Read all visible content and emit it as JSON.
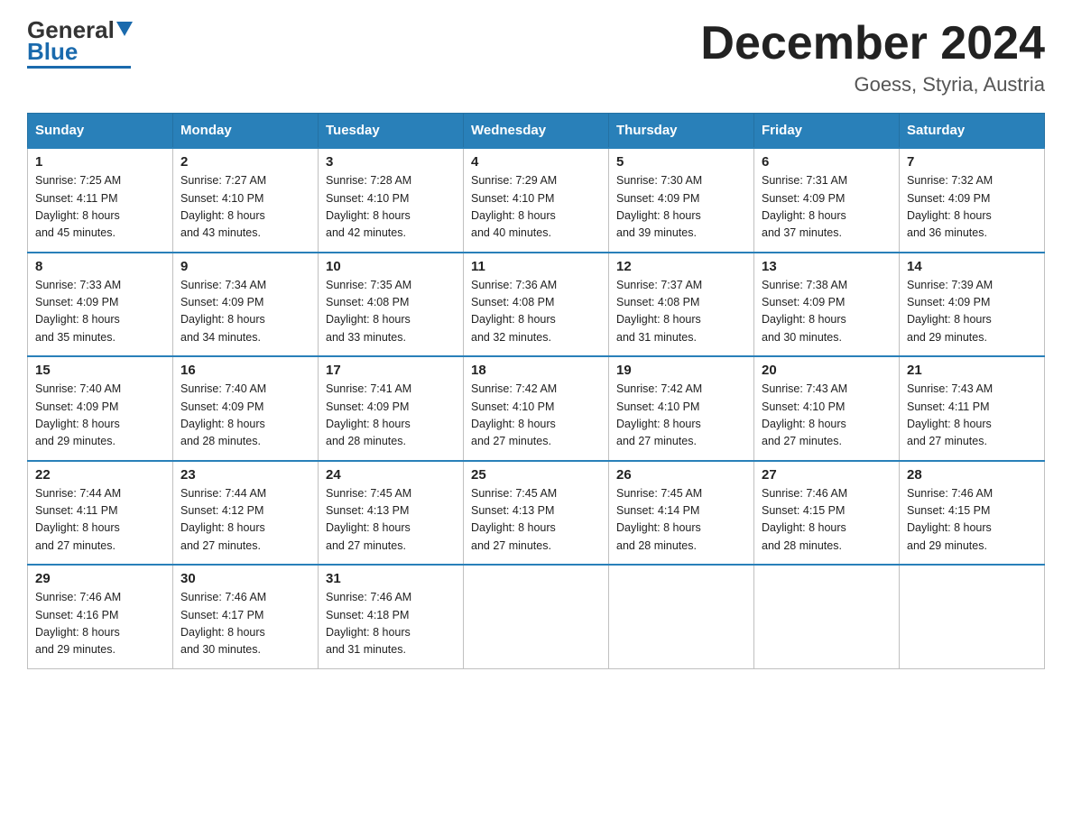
{
  "logo": {
    "general": "General",
    "blue": "Blue"
  },
  "title": "December 2024",
  "subtitle": "Goess, Styria, Austria",
  "weekdays": [
    "Sunday",
    "Monday",
    "Tuesday",
    "Wednesday",
    "Thursday",
    "Friday",
    "Saturday"
  ],
  "weeks": [
    [
      {
        "day": "1",
        "sunrise": "7:25 AM",
        "sunset": "4:11 PM",
        "daylight": "8 hours and 45 minutes."
      },
      {
        "day": "2",
        "sunrise": "7:27 AM",
        "sunset": "4:10 PM",
        "daylight": "8 hours and 43 minutes."
      },
      {
        "day": "3",
        "sunrise": "7:28 AM",
        "sunset": "4:10 PM",
        "daylight": "8 hours and 42 minutes."
      },
      {
        "day": "4",
        "sunrise": "7:29 AM",
        "sunset": "4:10 PM",
        "daylight": "8 hours and 40 minutes."
      },
      {
        "day": "5",
        "sunrise": "7:30 AM",
        "sunset": "4:09 PM",
        "daylight": "8 hours and 39 minutes."
      },
      {
        "day": "6",
        "sunrise": "7:31 AM",
        "sunset": "4:09 PM",
        "daylight": "8 hours and 37 minutes."
      },
      {
        "day": "7",
        "sunrise": "7:32 AM",
        "sunset": "4:09 PM",
        "daylight": "8 hours and 36 minutes."
      }
    ],
    [
      {
        "day": "8",
        "sunrise": "7:33 AM",
        "sunset": "4:09 PM",
        "daylight": "8 hours and 35 minutes."
      },
      {
        "day": "9",
        "sunrise": "7:34 AM",
        "sunset": "4:09 PM",
        "daylight": "8 hours and 34 minutes."
      },
      {
        "day": "10",
        "sunrise": "7:35 AM",
        "sunset": "4:08 PM",
        "daylight": "8 hours and 33 minutes."
      },
      {
        "day": "11",
        "sunrise": "7:36 AM",
        "sunset": "4:08 PM",
        "daylight": "8 hours and 32 minutes."
      },
      {
        "day": "12",
        "sunrise": "7:37 AM",
        "sunset": "4:08 PM",
        "daylight": "8 hours and 31 minutes."
      },
      {
        "day": "13",
        "sunrise": "7:38 AM",
        "sunset": "4:09 PM",
        "daylight": "8 hours and 30 minutes."
      },
      {
        "day": "14",
        "sunrise": "7:39 AM",
        "sunset": "4:09 PM",
        "daylight": "8 hours and 29 minutes."
      }
    ],
    [
      {
        "day": "15",
        "sunrise": "7:40 AM",
        "sunset": "4:09 PM",
        "daylight": "8 hours and 29 minutes."
      },
      {
        "day": "16",
        "sunrise": "7:40 AM",
        "sunset": "4:09 PM",
        "daylight": "8 hours and 28 minutes."
      },
      {
        "day": "17",
        "sunrise": "7:41 AM",
        "sunset": "4:09 PM",
        "daylight": "8 hours and 28 minutes."
      },
      {
        "day": "18",
        "sunrise": "7:42 AM",
        "sunset": "4:10 PM",
        "daylight": "8 hours and 27 minutes."
      },
      {
        "day": "19",
        "sunrise": "7:42 AM",
        "sunset": "4:10 PM",
        "daylight": "8 hours and 27 minutes."
      },
      {
        "day": "20",
        "sunrise": "7:43 AM",
        "sunset": "4:10 PM",
        "daylight": "8 hours and 27 minutes."
      },
      {
        "day": "21",
        "sunrise": "7:43 AM",
        "sunset": "4:11 PM",
        "daylight": "8 hours and 27 minutes."
      }
    ],
    [
      {
        "day": "22",
        "sunrise": "7:44 AM",
        "sunset": "4:11 PM",
        "daylight": "8 hours and 27 minutes."
      },
      {
        "day": "23",
        "sunrise": "7:44 AM",
        "sunset": "4:12 PM",
        "daylight": "8 hours and 27 minutes."
      },
      {
        "day": "24",
        "sunrise": "7:45 AM",
        "sunset": "4:13 PM",
        "daylight": "8 hours and 27 minutes."
      },
      {
        "day": "25",
        "sunrise": "7:45 AM",
        "sunset": "4:13 PM",
        "daylight": "8 hours and 27 minutes."
      },
      {
        "day": "26",
        "sunrise": "7:45 AM",
        "sunset": "4:14 PM",
        "daylight": "8 hours and 28 minutes."
      },
      {
        "day": "27",
        "sunrise": "7:46 AM",
        "sunset": "4:15 PM",
        "daylight": "8 hours and 28 minutes."
      },
      {
        "day": "28",
        "sunrise": "7:46 AM",
        "sunset": "4:15 PM",
        "daylight": "8 hours and 29 minutes."
      }
    ],
    [
      {
        "day": "29",
        "sunrise": "7:46 AM",
        "sunset": "4:16 PM",
        "daylight": "8 hours and 29 minutes."
      },
      {
        "day": "30",
        "sunrise": "7:46 AM",
        "sunset": "4:17 PM",
        "daylight": "8 hours and 30 minutes."
      },
      {
        "day": "31",
        "sunrise": "7:46 AM",
        "sunset": "4:18 PM",
        "daylight": "8 hours and 31 minutes."
      },
      null,
      null,
      null,
      null
    ]
  ],
  "labels": {
    "sunrise": "Sunrise:",
    "sunset": "Sunset:",
    "daylight": "Daylight:"
  }
}
